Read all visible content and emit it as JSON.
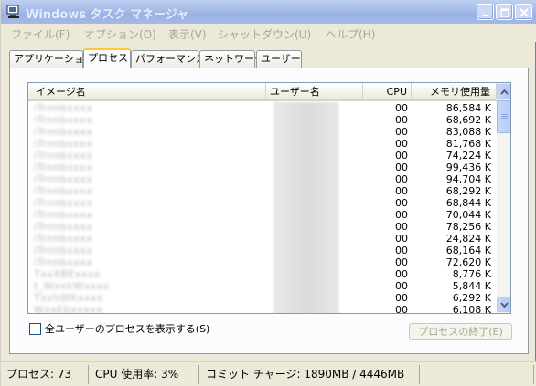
{
  "window": {
    "title": "Windows タスク マネージャ"
  },
  "menu": [
    "ファイル(F)",
    "オプション(O)",
    "表示(V)",
    "シャットダウン(U)",
    "ヘルプ(H)"
  ],
  "tabs": [
    "アプリケーション",
    "プロセス",
    "パフォーマンス",
    "ネットワーク",
    "ユーザー"
  ],
  "active_tab": "プロセス",
  "list": {
    "columns": {
      "name": "イメージ名",
      "user": "ユーザー名",
      "cpu": "CPU",
      "mem": "メモリ使用量"
    },
    "rows": [
      {
        "name": "iTrnnbxxxx",
        "cpu": "00",
        "mem": "86,584 K"
      },
      {
        "name": "iTrnnbxxxx",
        "cpu": "00",
        "mem": "68,692 K"
      },
      {
        "name": "iTrnnbxxxx",
        "cpu": "00",
        "mem": "83,088 K"
      },
      {
        "name": "iTrnnbxxxx",
        "cpu": "00",
        "mem": "81,768 K"
      },
      {
        "name": "iTrnnbxxxx",
        "cpu": "00",
        "mem": "74,224 K"
      },
      {
        "name": "iTrnnbxxxx",
        "cpu": "00",
        "mem": "99,436 K"
      },
      {
        "name": "iTrnnbxxxx",
        "cpu": "00",
        "mem": "94,704 K"
      },
      {
        "name": "iTrnnbxxxx",
        "cpu": "00",
        "mem": "68,292 K"
      },
      {
        "name": "iTrnnbxxxx",
        "cpu": "00",
        "mem": "68,844 K"
      },
      {
        "name": "iTrnnbxxxx",
        "cpu": "00",
        "mem": "70,044 K"
      },
      {
        "name": "iTrnnbxxxx",
        "cpu": "00",
        "mem": "78,256 K"
      },
      {
        "name": "iTrnnbxxxx",
        "cpu": "00",
        "mem": "24,824 K"
      },
      {
        "name": "iTrnnbxxxx",
        "cpu": "00",
        "mem": "68,164 K"
      },
      {
        "name": "iTrnnbxxxx",
        "cpu": "00",
        "mem": "72,620 K"
      },
      {
        "name": "TxxXBExxxx",
        "cpu": "00",
        "mem": "8,776 K"
      },
      {
        "name": "t_WxxkWxxxx",
        "cpu": "00",
        "mem": "5,844 K"
      },
      {
        "name": "TxxhWKxxxx",
        "cpu": "00",
        "mem": "6,292 K"
      },
      {
        "name": "WxxEbxxxxx",
        "cpu": "00",
        "mem": "6,108 K"
      }
    ]
  },
  "show_all_users_label": "全ユーザーのプロセスを表示する(S)",
  "end_process_label": "プロセスの終了(E)",
  "status": {
    "processes": "プロセス: 73",
    "cpu_usage": "CPU 使用率: 3%",
    "commit_charge": "コミット チャージ: 1890MB / 4446MB"
  }
}
